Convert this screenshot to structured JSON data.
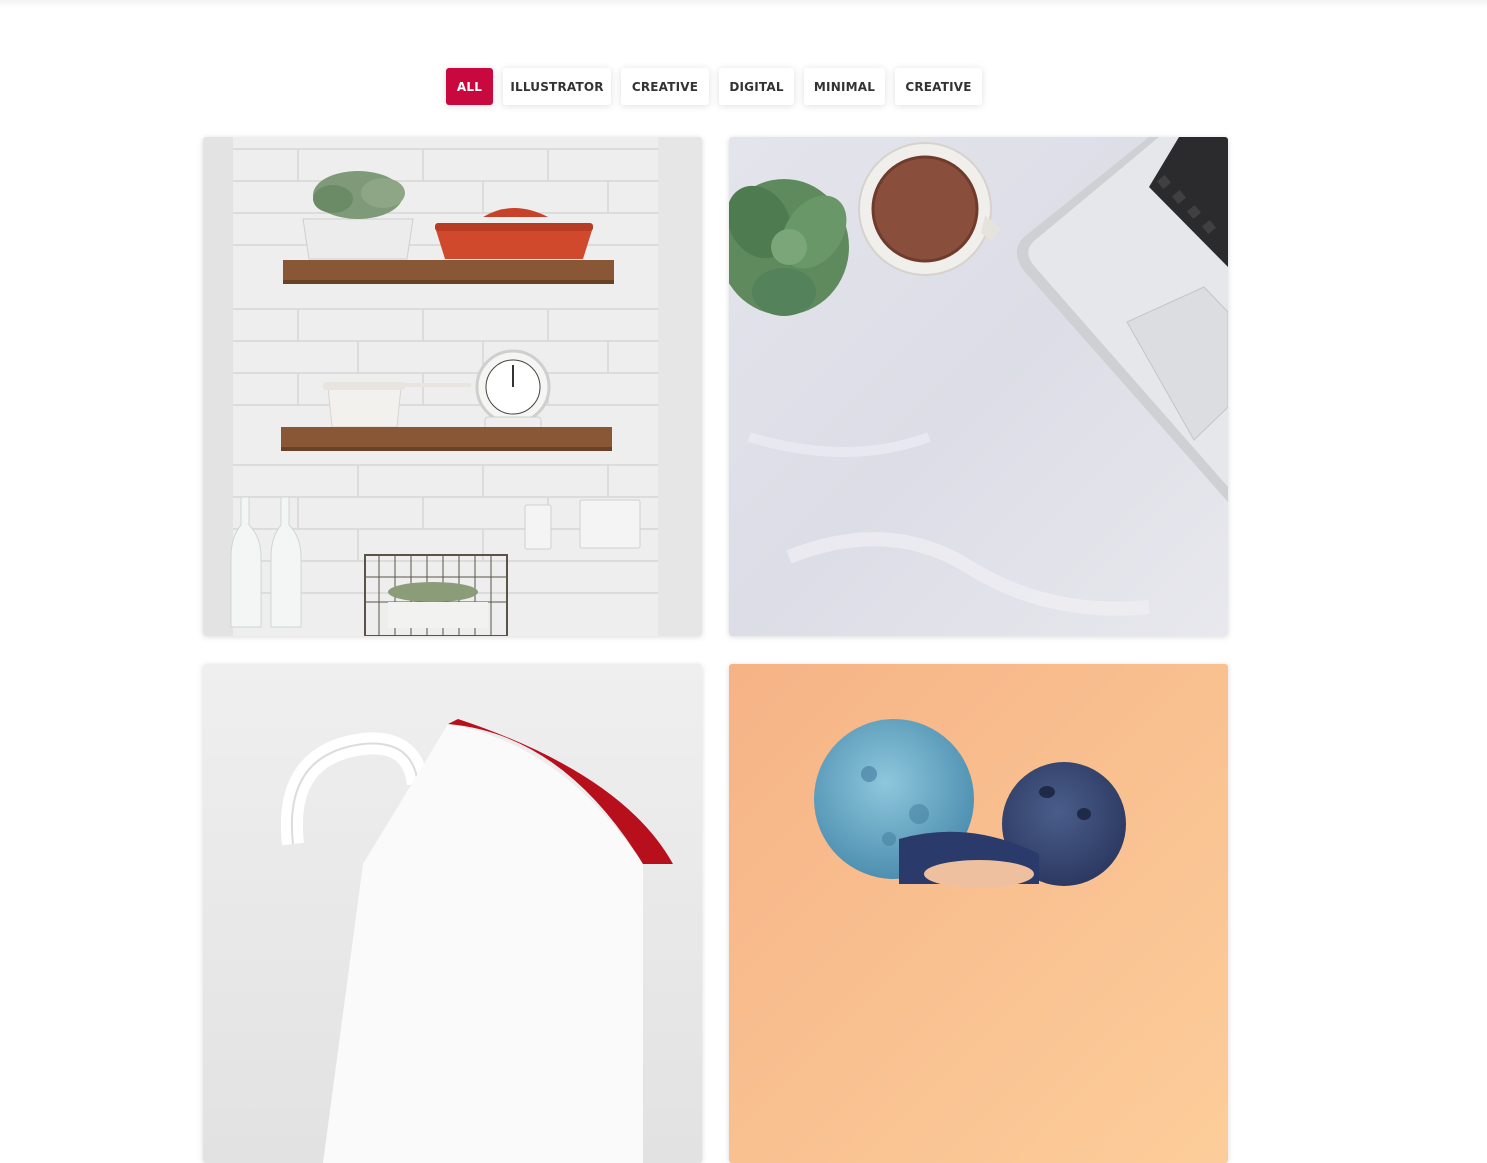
{
  "filters": {
    "items": [
      {
        "label": "ALL",
        "active": true
      },
      {
        "label": "ILLUSTRATOR",
        "active": false
      },
      {
        "label": "CREATIVE",
        "active": false
      },
      {
        "label": "DIGITAL",
        "active": false
      },
      {
        "label": "MINIMAL",
        "active": false
      },
      {
        "label": "CREATIVE",
        "active": false
      }
    ],
    "accent_color": "#c8083f"
  },
  "gallery": {
    "items": [
      {
        "subject": "kitchen shelves with plants and cookware"
      },
      {
        "subject": "desk top with succulent, tea cup and laptop"
      },
      {
        "subject": "white mug with red interior"
      },
      {
        "subject": "fluffy blue balls on orange background"
      }
    ]
  }
}
